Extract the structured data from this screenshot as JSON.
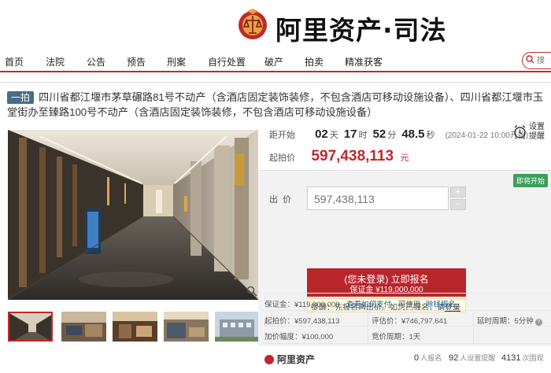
{
  "header": {
    "logo_text": "阿里资产·司法"
  },
  "nav": {
    "items": [
      "首页",
      "法院",
      "公告",
      "预告",
      "刑案",
      "自行处置",
      "破产",
      "拍卖",
      "精准获客"
    ],
    "search_placeholder": "搜"
  },
  "title": {
    "tag": "一拍",
    "text": "四川省都江堰市茅草碾路81号不动产（含酒店固定装饰装修，不包含酒店可移动设施设备）、四川省都江堰市玉堂街办至臻路100号不动产（含酒店固定装饰装修，不包含酒店可移动设施设备）"
  },
  "countdown": {
    "label": "距开始",
    "days": "02",
    "days_unit": "天",
    "hours": "17",
    "hours_unit": "时",
    "minutes": "52",
    "minutes_unit": "分",
    "seconds": "48.5",
    "seconds_unit": "秒",
    "start_date": "(2024-01-22 10:00开始)"
  },
  "reminder": {
    "label": "设置提醒"
  },
  "start_price": {
    "label": "起拍价",
    "value": "597,438,113",
    "unit": "元"
  },
  "status_badge": "即将开始",
  "bid": {
    "label": "出价",
    "value": "597,438,113",
    "plus": "+",
    "minus": "−"
  },
  "signup": {
    "line1": "(您未登录) 立即报名",
    "line2": "保证金 ¥119,000,000"
  },
  "hint": {
    "text": "提醒：先报名再出价。如您已报名，请",
    "link": "登录"
  },
  "stats": {
    "logo": "阿里资产",
    "signups": "0",
    "signups_label": "人报名",
    "reminders": "92",
    "reminders_label": "人设置提醒",
    "views": "4131",
    "views_label": "次围观"
  },
  "info": {
    "deposit_label": "保证金：",
    "deposit_value": "¥119,000,000",
    "deposit_link": "查看如何支付",
    "deposit_use": "可使用",
    "deposit_use_link": "赊钱报名",
    "start_price_label": "起拍价：",
    "start_price_value": "¥597,438,113",
    "assessed_label": "评估价：",
    "assessed_value": "¥746,797,641",
    "delay_label": "延时周期：",
    "delay_value": "5分钟",
    "increment_label": "加价幅度：",
    "increment_value": "¥100,000",
    "cycle_label": "竞价周期：",
    "cycle_value": "1天"
  },
  "colors": {
    "brand_red": "#c2272d",
    "green_badge": "#3c9f5c",
    "link_blue": "#1a5ea8"
  }
}
